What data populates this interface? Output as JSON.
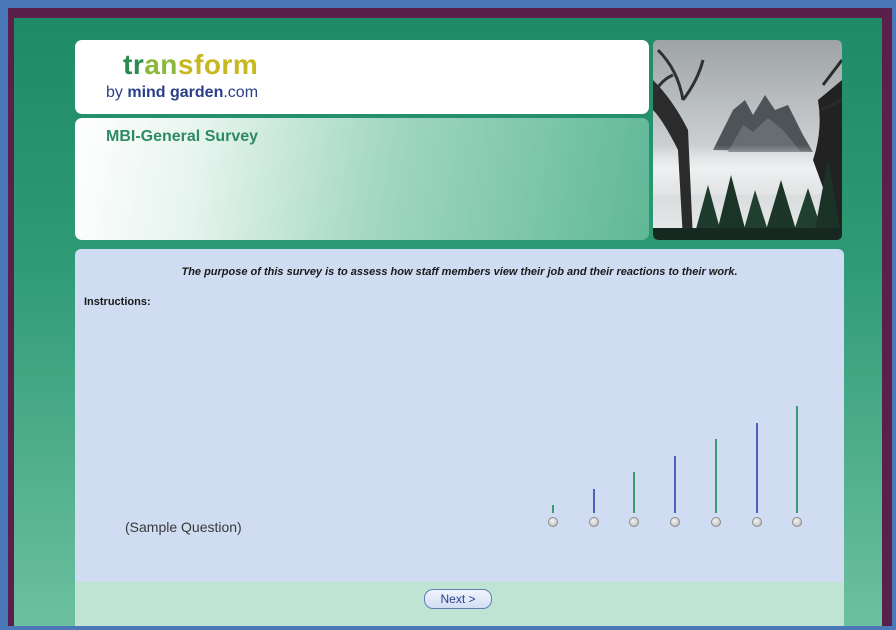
{
  "header": {
    "logo_word": {
      "part1": "tr",
      "part2": "an",
      "part3": "sform"
    },
    "logo_sub": {
      "by": "by ",
      "brand": "mind garden",
      "domain": ".com"
    },
    "survey_title": "MBI-General Survey"
  },
  "content": {
    "purpose": "The purpose of this survey is to assess how staff members view their job and their reactions to their work.",
    "instructions_label": "Instructions:",
    "sample_question": "(Sample Question)",
    "scale": [
      {
        "level": 0,
        "color": "#3a9a72"
      },
      {
        "level": 1,
        "color": "#4a62b8"
      },
      {
        "level": 2,
        "color": "#3a9a72"
      },
      {
        "level": 3,
        "color": "#4a62b8"
      },
      {
        "level": 4,
        "color": "#3a9a72"
      },
      {
        "level": 5,
        "color": "#4a62b8"
      },
      {
        "level": 6,
        "color": "#3a9a72"
      }
    ]
  },
  "footer": {
    "next_label": "Next >"
  }
}
